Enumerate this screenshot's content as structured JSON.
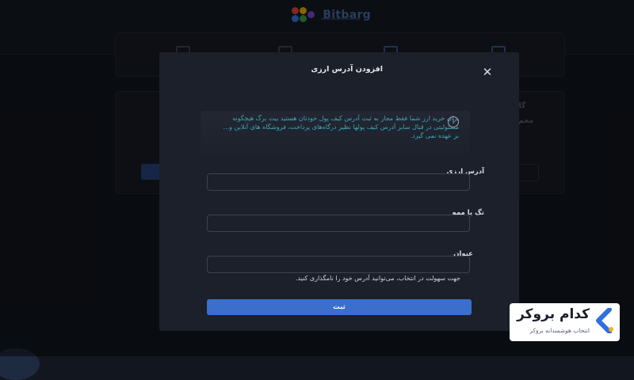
{
  "brand": {
    "logo_text": "Bitbarg"
  },
  "background": {
    "step_label": "گام",
    "row_label": "محم"
  },
  "modal": {
    "title": "افزودن آدرس ارزی",
    "close_icon": "close-icon",
    "notice": "برای خرید ارز شما فقط مجاز به ثبت آدرس کیف پول خودتان هستید بیت برگ هیچگونه مسئولیتی در قبال سایر آدرس کیف پولها نظیر درگاه‌های پرداخت، فروشگاه های آنلاین و... بر عهده نمی گیرد.",
    "fields": [
      {
        "label": "آدرس ارزی",
        "value": "",
        "placeholder": ""
      },
      {
        "label": "تگ یا ممو",
        "value": "",
        "placeholder": ""
      },
      {
        "label": "عنوان",
        "value": "",
        "placeholder": ""
      }
    ],
    "hint": "جهت سهولت در انتخاب، می‌توانید آدرس خود را نامگذاری کنید.",
    "submit_label": "ثبت"
  },
  "badge": {
    "title": "کدام بروکر",
    "subtitle": "انتخاب هوشمندانه بروکر"
  },
  "colors": {
    "background": "#12161e",
    "modal": "#1b202a",
    "accent": "#3a6fcc",
    "notice_text": "#3fa7b6"
  }
}
